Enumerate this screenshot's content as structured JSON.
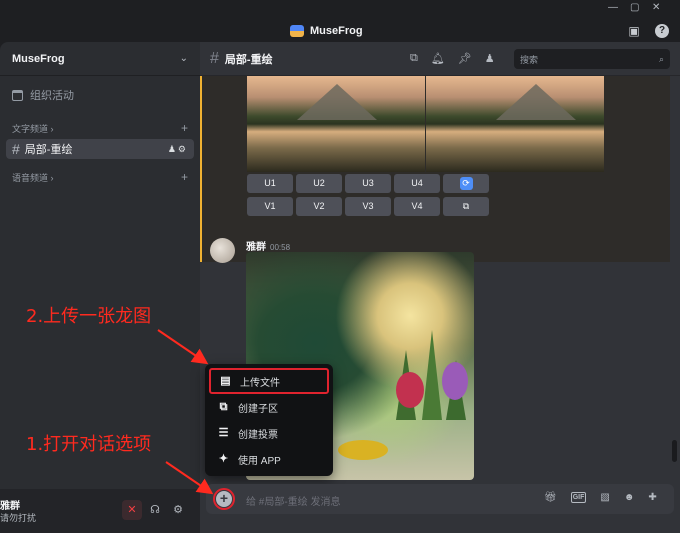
{
  "window": {
    "title": "MuseFrog",
    "controls": [
      "—",
      "▢",
      "✕"
    ]
  },
  "sidebar": {
    "server_name": "MuseFrog",
    "events_label": "组织活动",
    "text_category": "文字频道 ›",
    "active_channel": "局部-重绘",
    "voice_category": "语音频道 ›"
  },
  "user": {
    "name": "雅群",
    "status": "请勿打扰"
  },
  "channel_header": {
    "name": "局部-重绘",
    "search_placeholder": "搜索"
  },
  "message1": {
    "buttons_row1": [
      "U1",
      "U2",
      "U3",
      "U4"
    ],
    "buttons_row2": [
      "V1",
      "V2",
      "V3",
      "V4"
    ]
  },
  "message2": {
    "author": "雅群",
    "time": "00:58"
  },
  "popup_menu": {
    "items": [
      "上传文件",
      "创建子区",
      "创建投票",
      "使用 APP"
    ]
  },
  "composer": {
    "placeholder": "给 #局部-重绘 发消息"
  },
  "annotations": {
    "step2": "2.上传一张龙图",
    "step1": "1.打开对话选项"
  },
  "colors": {
    "annotation_red": "#ff2a1f",
    "accent_blue": "#4e8ef7",
    "mention_bar": "#f0b232"
  }
}
